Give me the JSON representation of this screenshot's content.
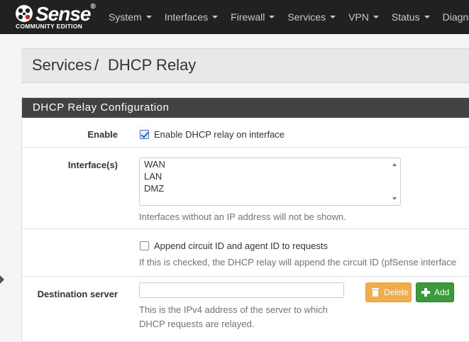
{
  "brand": {
    "name": "Sense",
    "registered": "®",
    "edition": "COMMUNITY EDITION"
  },
  "nav": {
    "items": [
      {
        "label": "System"
      },
      {
        "label": "Interfaces"
      },
      {
        "label": "Firewall"
      },
      {
        "label": "Services"
      },
      {
        "label": "VPN"
      },
      {
        "label": "Status"
      },
      {
        "label": "Diagnostics"
      }
    ]
  },
  "breadcrumb": {
    "parent": "Services",
    "separator": "/",
    "current": "DHCP Relay"
  },
  "panel": {
    "title": "DHCP Relay Configuration"
  },
  "form": {
    "enable": {
      "label": "Enable",
      "checked": true,
      "text": "Enable DHCP relay on interface"
    },
    "interfaces": {
      "label": "Interface(s)",
      "options": [
        "WAN",
        "LAN",
        "DMZ"
      ],
      "help": "Interfaces without an IP address will not be shown."
    },
    "circuit": {
      "checked": false,
      "text": "Append circuit ID and agent ID to requests",
      "help": "If this is checked, the DHCP relay will append the circuit ID (pfSense interface"
    },
    "destination": {
      "label": "Destination server",
      "value": "",
      "help_line1": "This is the IPv4 address of the server to which",
      "help_line2": "DHCP requests are relayed.",
      "delete_label": "Delete",
      "add_label": "Add"
    }
  },
  "colors": {
    "navbar": "#212121",
    "panel_heading": "#424242",
    "breadcrumb_separator": "#d9534f",
    "delete_button": "#f0ad4e",
    "add_button": "#3c9a3c"
  }
}
